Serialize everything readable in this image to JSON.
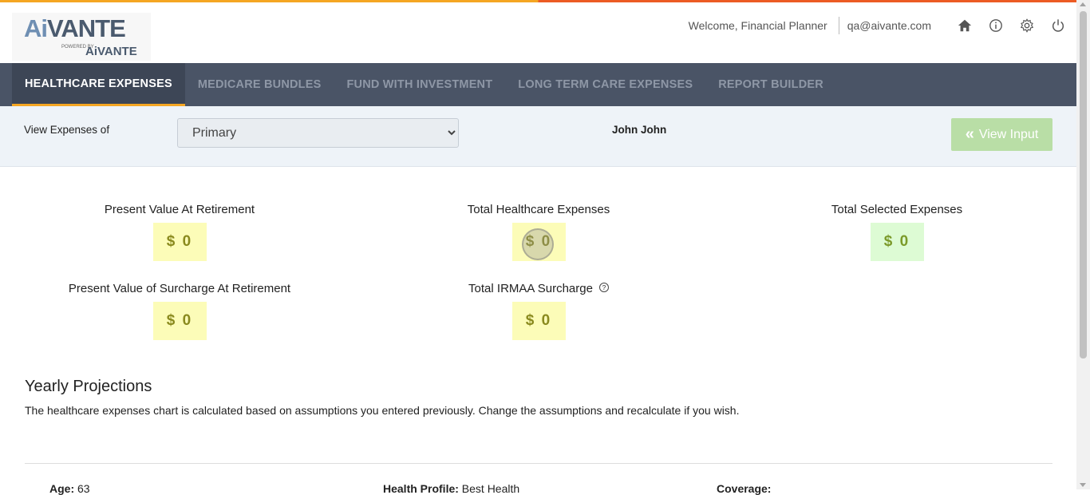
{
  "header": {
    "logo": {
      "main_ai": "Ai",
      "main_rest": "VANTE",
      "powered_by": "POWERED BY",
      "sub_brand": "AiVANTE"
    },
    "welcome": "Welcome, Financial Planner",
    "email": "qa@aivante.com",
    "icons": [
      "home-icon",
      "info-icon",
      "gear-icon",
      "power-icon"
    ]
  },
  "nav": {
    "tabs": [
      {
        "label": "HEALTHCARE EXPENSES",
        "active": true
      },
      {
        "label": "MEDICARE BUNDLES",
        "active": false
      },
      {
        "label": "FUND WITH INVESTMENT",
        "active": false
      },
      {
        "label": "LONG TERM CARE EXPENSES",
        "active": false
      },
      {
        "label": "REPORT BUILDER",
        "active": false
      }
    ]
  },
  "filter": {
    "label": "View Expenses of",
    "selected": "Primary",
    "person_name": "John John",
    "view_input_label": "View Input"
  },
  "stats": {
    "pv_retirement": {
      "title": "Present Value At Retirement",
      "value": "$ 0"
    },
    "total_healthcare": {
      "title": "Total Healthcare Expenses",
      "value": "$ 0"
    },
    "total_selected": {
      "title": "Total Selected Expenses",
      "value": "$ 0"
    },
    "pv_surcharge": {
      "title": "Present Value of Surcharge At Retirement",
      "value": "$ 0"
    },
    "total_irmaa": {
      "title": "Total IRMAA Surcharge",
      "value": "$ 0",
      "help": "?"
    }
  },
  "projections": {
    "title": "Yearly Projections",
    "description": "The healthcare expenses chart is calculated based on assumptions you entered previously. Change the assumptions and recalculate if you wish.",
    "bottom": {
      "age_label": "Age:",
      "age_value": "63",
      "health_label": "Health Profile:",
      "health_value": "Best Health",
      "coverage_label": "Coverage:",
      "coverage_value": ""
    }
  },
  "colors": {
    "nav_bg": "#4a5466",
    "accent": "#f5a623",
    "value_yellow": "#fcfcb8",
    "value_green": "#ddfbd4",
    "view_input": "#b9dea6"
  }
}
